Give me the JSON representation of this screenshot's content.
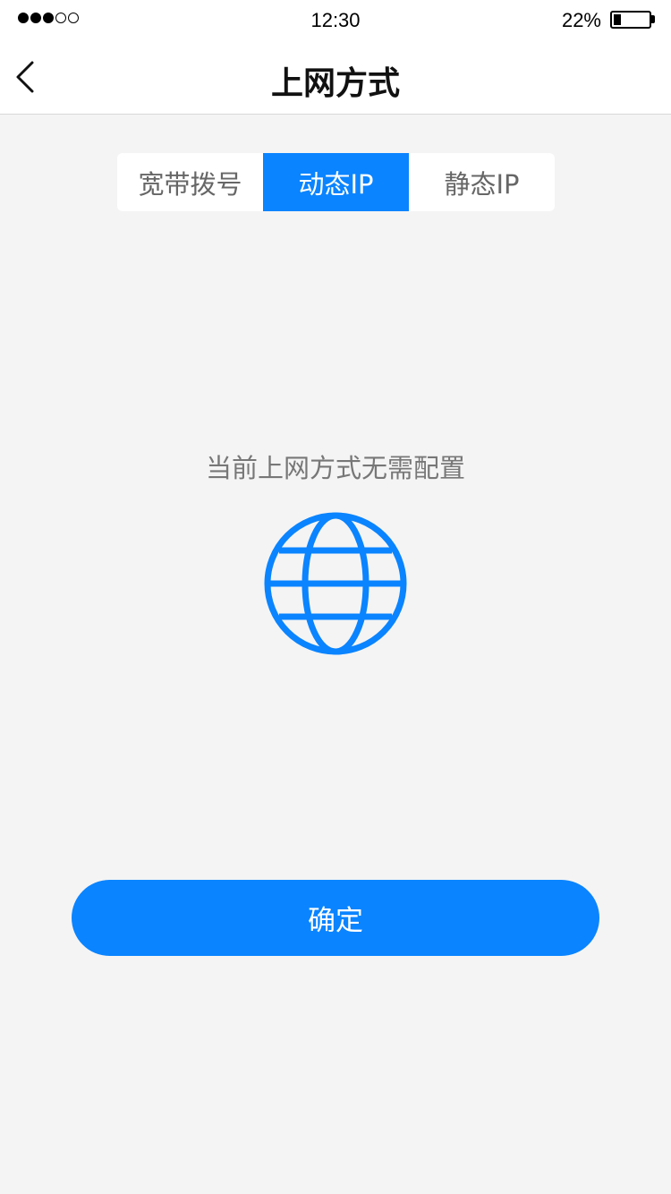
{
  "status_bar": {
    "signal_filled": 3,
    "signal_total": 5,
    "time": "12:30",
    "battery_percent": "22%",
    "battery_level": 0.22
  },
  "nav": {
    "back_icon": "chevron-left-icon",
    "title": "上网方式"
  },
  "tabs": [
    {
      "label": "宽带拨号",
      "active": false
    },
    {
      "label": "动态IP",
      "active": true
    },
    {
      "label": "静态IP",
      "active": false
    }
  ],
  "content": {
    "message": "当前上网方式无需配置",
    "icon": "globe-icon",
    "accent_color": "#0a84ff"
  },
  "confirm_label": "确定"
}
